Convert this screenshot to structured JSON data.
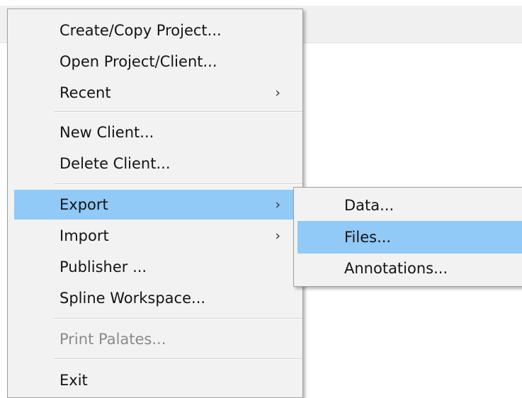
{
  "main_menu": {
    "create_copy_project": "Create/Copy Project...",
    "open_project_client": "Open Project/Client...",
    "recent": "Recent",
    "new_client": "New Client...",
    "delete_client": "Delete Client...",
    "export": "Export",
    "import": "Import",
    "publisher": "Publisher ...",
    "spline_workspace": "Spline Workspace...",
    "print_palates": "Print Palates...",
    "exit": "Exit",
    "submenu_arrow": "›"
  },
  "export_submenu": {
    "data": "Data...",
    "files": "Files...",
    "annotations": "Annotations..."
  },
  "colors": {
    "highlight": "#91c9f7",
    "menu_background": "#f2f2f2",
    "disabled_text": "#8a8a8a"
  },
  "icons": {
    "submenu_indicator": "chevron-right-icon"
  }
}
